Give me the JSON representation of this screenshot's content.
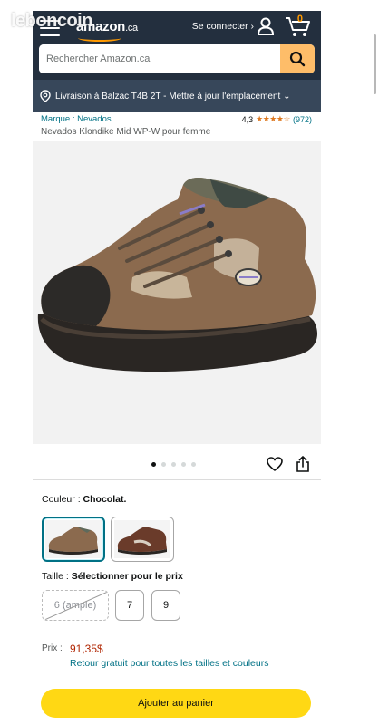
{
  "header": {
    "logo_text": "amazon",
    "logo_tld": ".ca",
    "signin_label": "Se connecter ›",
    "cart_count": "0"
  },
  "search": {
    "placeholder": "Rechercher Amazon.ca"
  },
  "delivery": {
    "text": "Livraison à Balzac T4B 2T - Mettre à jour l'emplacement ⌄"
  },
  "product": {
    "brand": "Marque : Nevados",
    "rating_value": "4,3",
    "rating_stars": 4.3,
    "rating_count": "(972)",
    "title": "Nevados Klondike Mid WP-W pour femme",
    "image_count": 5,
    "image_active": 1
  },
  "color": {
    "label": "Couleur : ",
    "selected": "Chocolat.",
    "swatches": [
      "chocolat",
      "brun-rouge"
    ]
  },
  "size": {
    "label": "Taille : ",
    "selected": "Sélectionner pour le prix",
    "options": [
      "6 (ample)",
      "7",
      "9"
    ],
    "unavailable": [
      "6 (ample)"
    ]
  },
  "price": {
    "label": "Prix :",
    "value": "91,35$",
    "free_return": "Retour gratuit pour toutes les tailles et couleurs"
  },
  "actions": {
    "add_to_cart": "Ajouter au panier"
  },
  "watermark": "leboncoin",
  "colors": {
    "header_bg": "#232f3e",
    "delivery_bg": "#37475a",
    "accent_orange": "#ff9900",
    "search_btn": "#febd69",
    "link": "#007185",
    "price": "#b12704",
    "cart_button": "#ffd814"
  }
}
